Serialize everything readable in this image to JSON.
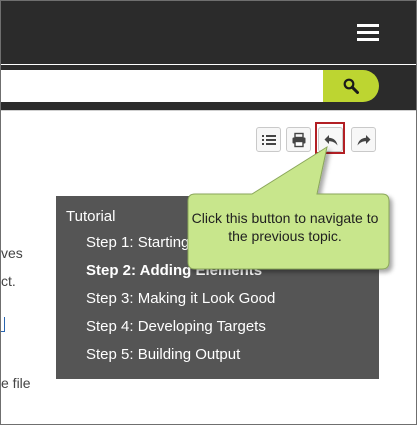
{
  "header": {
    "menu_icon": "hamburger-icon"
  },
  "search": {
    "value": "",
    "placeholder": "",
    "button_icon": "search-icon"
  },
  "toolbar": {
    "buttons": [
      {
        "name": "toc-list",
        "icon": "list-icon"
      },
      {
        "name": "print",
        "icon": "printer-icon"
      },
      {
        "name": "previous-topic",
        "icon": "back-arrow-icon"
      },
      {
        "name": "next-topic",
        "icon": "forward-arrow-icon"
      }
    ]
  },
  "background_text": {
    "fragment_1": "ves",
    "fragment_2": "ct.",
    "fragment_3": "e file"
  },
  "menu": {
    "title": "Tutorial",
    "items": [
      {
        "label": "Step 1: Starting a Project",
        "active": false
      },
      {
        "label": "Step 2: Adding Elements",
        "active": true
      },
      {
        "label": "Step 3: Making it Look Good",
        "active": false
      },
      {
        "label": "Step 4: Developing Targets",
        "active": false
      },
      {
        "label": "Step 5: Building Output",
        "active": false
      }
    ]
  },
  "callout": {
    "text": "Click this button to navigate to the previous topic."
  },
  "colors": {
    "header_bg": "#2b2b2b",
    "search_button": "#bdd531",
    "menu_bg": "#555555",
    "callout_bg": "#c8e68c",
    "highlight_border": "#b21f24"
  }
}
